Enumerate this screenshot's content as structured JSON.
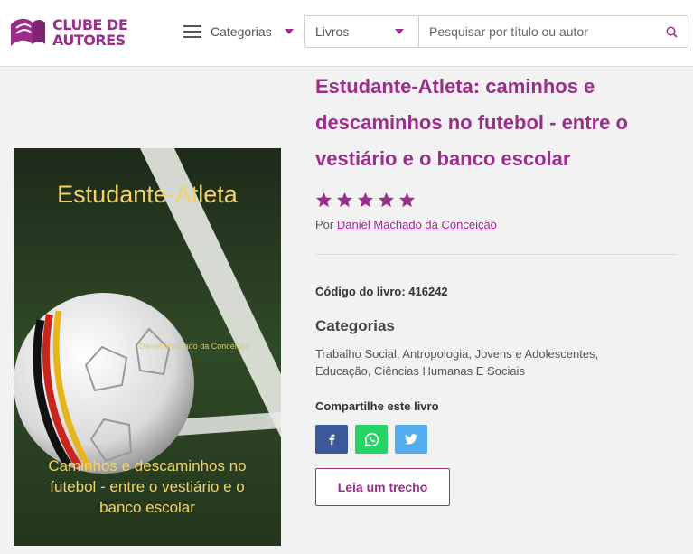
{
  "header": {
    "logo_line1": "CLUBE DE",
    "logo_line2": "AUTORES",
    "categories_label": "Categorias",
    "search_type": "Livros",
    "search_placeholder": "Pesquisar por título ou autor",
    "brand_color": "#9b2e8a"
  },
  "book": {
    "title": "Estudante-Atleta: caminhos e descaminhos no futebol - entre o vestiário e o banco escolar",
    "rating": 5,
    "by_label": "Por",
    "author": "Daniel Machado da Conceição",
    "code_label": "Código do livro:",
    "code": "416242",
    "categories_heading": "Categorias",
    "categories": "Trabalho Social, Antropologia, Jovens e Adolescentes, Educação, Ciências Humanas E Sociais",
    "share_heading": "Compartilhe este livro",
    "share": [
      {
        "network": "facebook",
        "icon": "facebook-icon",
        "color": "#3b5998"
      },
      {
        "network": "whatsapp",
        "icon": "whatsapp-icon",
        "color": "#25d366"
      },
      {
        "network": "twitter",
        "icon": "twitter-icon",
        "color": "#55acee"
      }
    ],
    "excerpt_button": "Leia um trecho"
  },
  "cover": {
    "title": "Estudante-Atleta",
    "author": "Daniel Machado da Conceição",
    "subtitle_line1": "Caminhos e descaminhos no",
    "subtitle_line2": "futebol - entre o vestiário e o",
    "subtitle_line3": "banco escolar"
  }
}
